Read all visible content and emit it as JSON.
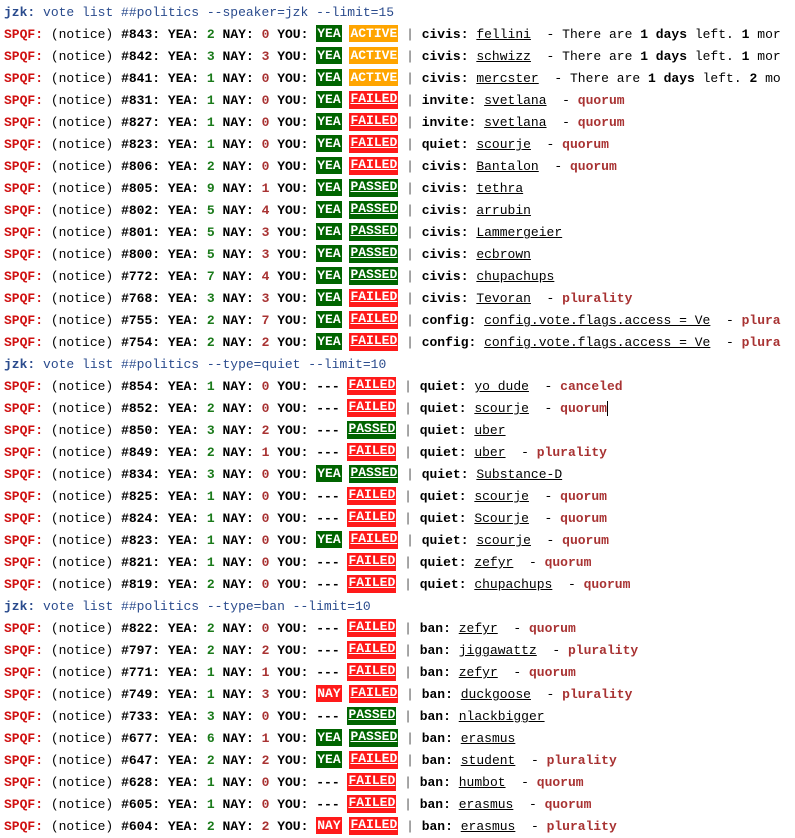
{
  "colors": {
    "command": "#2a4b8d",
    "nick": "#d01010",
    "yea_count": "#1a7a1a",
    "nay_count": "#a83232",
    "you_yea_bg": "#006400",
    "you_nay_bg": "#ff1a1a",
    "active_bg": "#ffa500",
    "failed_bg": "#ff1a1a",
    "passed_bg": "#006400",
    "reason": "#a83232"
  },
  "labels": {
    "yea": "YEA:",
    "nay": "NAY:",
    "you": "YOU:",
    "notice": "(notice)",
    "separator": "|",
    "days_text_pre": "There are",
    "days_text_bold": "1 days",
    "days_text_post": "left."
  },
  "blocks": [
    {
      "command": {
        "nick": "jzk:",
        "text": "vote list ##politics --speaker=jzk --limit=15"
      },
      "rows": [
        {
          "nick": "SPQF:",
          "id": "#843:",
          "yea": "2",
          "nay": "0",
          "you": "YEA",
          "status": "ACTIVE",
          "type": "civis:",
          "target": "fellini",
          "tail_pre": "There are",
          "tail_bold1": "1 days",
          "tail_mid": "left.",
          "tail_bold2": "1",
          "tail_post": "mor"
        },
        {
          "nick": "SPQF:",
          "id": "#842:",
          "yea": "3",
          "nay": "3",
          "you": "YEA",
          "status": "ACTIVE",
          "type": "civis:",
          "target": "schwizz",
          "tail_pre": "There are",
          "tail_bold1": "1 days",
          "tail_mid": "left.",
          "tail_bold2": "1",
          "tail_post": "mor"
        },
        {
          "nick": "SPQF:",
          "id": "#841:",
          "yea": "1",
          "nay": "0",
          "you": "YEA",
          "status": "ACTIVE",
          "type": "civis:",
          "target": "mercster",
          "tail_pre": "There are",
          "tail_bold1": "1 days",
          "tail_mid": "left.",
          "tail_bold2": "2",
          "tail_post": "mo"
        },
        {
          "nick": "SPQF:",
          "id": "#831:",
          "yea": "1",
          "nay": "0",
          "you": "YEA",
          "status": "FAILED",
          "type": "invite:",
          "target": "svetlana",
          "reason": "quorum"
        },
        {
          "nick": "SPQF:",
          "id": "#827:",
          "yea": "1",
          "nay": "0",
          "you": "YEA",
          "status": "FAILED",
          "type": "invite:",
          "target": "svetlana",
          "reason": "quorum"
        },
        {
          "nick": "SPQF:",
          "id": "#823:",
          "yea": "1",
          "nay": "0",
          "you": "YEA",
          "status": "FAILED",
          "type": "quiet:",
          "target": "scourje",
          "reason": "quorum"
        },
        {
          "nick": "SPQF:",
          "id": "#806:",
          "yea": "2",
          "nay": "0",
          "you": "YEA",
          "status": "FAILED",
          "type": "civis:",
          "target": "Bantalon",
          "reason": "quorum"
        },
        {
          "nick": "SPQF:",
          "id": "#805:",
          "yea": "9",
          "nay": "1",
          "you": "YEA",
          "status": "PASSED",
          "type": "civis:",
          "target": "tethra"
        },
        {
          "nick": "SPQF:",
          "id": "#802:",
          "yea": "5",
          "nay": "4",
          "you": "YEA",
          "status": "PASSED",
          "type": "civis:",
          "target": "arrubin"
        },
        {
          "nick": "SPQF:",
          "id": "#801:",
          "yea": "5",
          "nay": "3",
          "you": "YEA",
          "status": "PASSED",
          "type": "civis:",
          "target": "Lammergeier"
        },
        {
          "nick": "SPQF:",
          "id": "#800:",
          "yea": "5",
          "nay": "3",
          "you": "YEA",
          "status": "PASSED",
          "type": "civis:",
          "target": "ecbrown"
        },
        {
          "nick": "SPQF:",
          "id": "#772:",
          "yea": "7",
          "nay": "4",
          "you": "YEA",
          "status": "PASSED",
          "type": "civis:",
          "target": "chupachups"
        },
        {
          "nick": "SPQF:",
          "id": "#768:",
          "yea": "3",
          "nay": "3",
          "you": "YEA",
          "status": "FAILED",
          "type": "civis:",
          "target": "Tevoran",
          "reason": "plurality"
        },
        {
          "nick": "SPQF:",
          "id": "#755:",
          "yea": "2",
          "nay": "7",
          "you": "YEA",
          "status": "FAILED",
          "type": "config:",
          "target": "config.vote.flags.access = Ve",
          "reason": "plura"
        },
        {
          "nick": "SPQF:",
          "id": "#754:",
          "yea": "2",
          "nay": "2",
          "you": "YEA",
          "status": "FAILED",
          "type": "config:",
          "target": "config.vote.flags.access = Ve",
          "reason": "plura"
        }
      ]
    },
    {
      "command": {
        "nick": "jzk:",
        "text": "vote list ##politics --type=quiet --limit=10"
      },
      "rows": [
        {
          "nick": "SPQF:",
          "id": "#854:",
          "yea": "1",
          "nay": "0",
          "you": "---",
          "status": "FAILED",
          "type": "quiet:",
          "target": "yo_dude",
          "reason": "canceled"
        },
        {
          "nick": "SPQF:",
          "id": "#852:",
          "yea": "2",
          "nay": "0",
          "you": "---",
          "status": "FAILED",
          "type": "quiet:",
          "target": "scourje",
          "reason": "quorum",
          "cursor": true
        },
        {
          "nick": "SPQF:",
          "id": "#850:",
          "yea": "3",
          "nay": "2",
          "you": "---",
          "status": "PASSED",
          "type": "quiet:",
          "target": "uber"
        },
        {
          "nick": "SPQF:",
          "id": "#849:",
          "yea": "2",
          "nay": "1",
          "you": "---",
          "status": "FAILED",
          "type": "quiet:",
          "target": "uber",
          "reason": "plurality"
        },
        {
          "nick": "SPQF:",
          "id": "#834:",
          "yea": "3",
          "nay": "0",
          "you": "YEA",
          "status": "PASSED",
          "type": "quiet:",
          "target": "Substance-D"
        },
        {
          "nick": "SPQF:",
          "id": "#825:",
          "yea": "1",
          "nay": "0",
          "you": "---",
          "status": "FAILED",
          "type": "quiet:",
          "target": "scourje",
          "reason": "quorum"
        },
        {
          "nick": "SPQF:",
          "id": "#824:",
          "yea": "1",
          "nay": "0",
          "you": "---",
          "status": "FAILED",
          "type": "quiet:",
          "target": "Scourje",
          "reason": "quorum"
        },
        {
          "nick": "SPQF:",
          "id": "#823:",
          "yea": "1",
          "nay": "0",
          "you": "YEA",
          "status": "FAILED",
          "type": "quiet:",
          "target": "scourje",
          "reason": "quorum"
        },
        {
          "nick": "SPQF:",
          "id": "#821:",
          "yea": "1",
          "nay": "0",
          "you": "---",
          "status": "FAILED",
          "type": "quiet:",
          "target": "zefyr",
          "reason": "quorum"
        },
        {
          "nick": "SPQF:",
          "id": "#819:",
          "yea": "2",
          "nay": "0",
          "you": "---",
          "status": "FAILED",
          "type": "quiet:",
          "target": "chupachups",
          "reason": "quorum"
        }
      ]
    },
    {
      "command": {
        "nick": "jzk:",
        "text": "vote list ##politics --type=ban --limit=10"
      },
      "rows": [
        {
          "nick": "SPQF:",
          "id": "#822:",
          "yea": "2",
          "nay": "0",
          "you": "---",
          "status": "FAILED",
          "type": "ban:",
          "target": "zefyr",
          "reason": "quorum"
        },
        {
          "nick": "SPQF:",
          "id": "#797:",
          "yea": "2",
          "nay": "2",
          "you": "---",
          "status": "FAILED",
          "type": "ban:",
          "target": "jiggawattz",
          "reason": "plurality"
        },
        {
          "nick": "SPQF:",
          "id": "#771:",
          "yea": "1",
          "nay": "1",
          "you": "---",
          "status": "FAILED",
          "type": "ban:",
          "target": "zefyr",
          "reason": "quorum"
        },
        {
          "nick": "SPQF:",
          "id": "#749:",
          "yea": "1",
          "nay": "3",
          "you": "NAY",
          "status": "FAILED",
          "type": "ban:",
          "target": "duckgoose",
          "reason": "plurality"
        },
        {
          "nick": "SPQF:",
          "id": "#733:",
          "yea": "3",
          "nay": "0",
          "you": "---",
          "status": "PASSED",
          "type": "ban:",
          "target": "nlackbigger"
        },
        {
          "nick": "SPQF:",
          "id": "#677:",
          "yea": "6",
          "nay": "1",
          "you": "YEA",
          "status": "PASSED",
          "type": "ban:",
          "target": "erasmus"
        },
        {
          "nick": "SPQF:",
          "id": "#647:",
          "yea": "2",
          "nay": "2",
          "you": "YEA",
          "status": "FAILED",
          "type": "ban:",
          "target": "student",
          "reason": "plurality"
        },
        {
          "nick": "SPQF:",
          "id": "#628:",
          "yea": "1",
          "nay": "0",
          "you": "---",
          "status": "FAILED",
          "type": "ban:",
          "target": "humbot",
          "reason": "quorum"
        },
        {
          "nick": "SPQF:",
          "id": "#605:",
          "yea": "1",
          "nay": "0",
          "you": "---",
          "status": "FAILED",
          "type": "ban:",
          "target": "erasmus",
          "reason": "quorum"
        },
        {
          "nick": "SPQF:",
          "id": "#604:",
          "yea": "2",
          "nay": "2",
          "you": "NAY",
          "status": "FAILED",
          "type": "ban:",
          "target": "erasmus",
          "reason": "plurality"
        }
      ]
    }
  ]
}
